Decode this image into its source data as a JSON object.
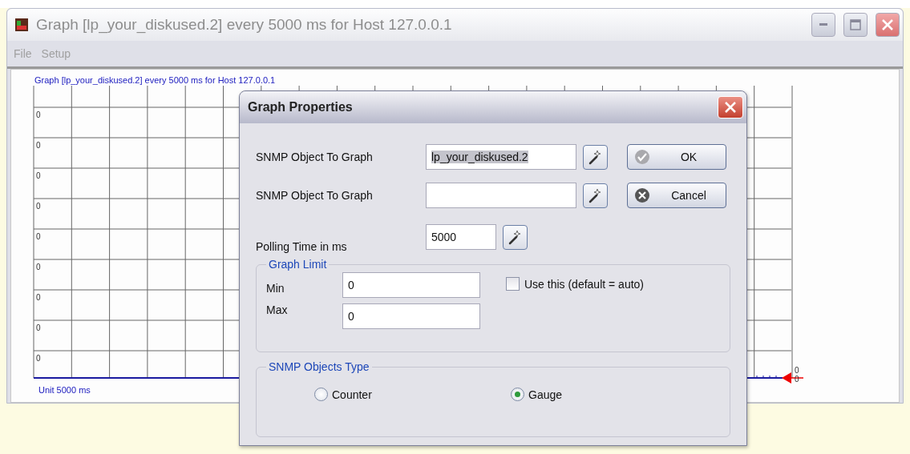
{
  "window": {
    "title": "Graph [lp_your_diskused.2] every 5000 ms for Host 127.0.0.1",
    "menu": [
      "File",
      "Setup"
    ]
  },
  "graph": {
    "title": "Graph [lp_your_diskused.2] every 5000 ms for Host 127.0.0.1",
    "y_labels": [
      "0",
      "0",
      "0",
      "0",
      "0",
      "0",
      "0",
      "0",
      "0"
    ],
    "unit": "Unit 5000 ms",
    "end_labels": [
      "0",
      "0"
    ]
  },
  "dialog": {
    "title": "Graph Properties",
    "rows": [
      {
        "label": "SNMP Object To Graph",
        "value": "lp_your_diskused.2",
        "highlighted": true,
        "button": {
          "kind": "ok",
          "label": "OK"
        }
      },
      {
        "label": "SNMP Object To Graph",
        "button": {
          "kind": "cancel",
          "label": "Cancel"
        }
      },
      {
        "label": "Polling Time in ms",
        "value": "5000"
      }
    ],
    "graph_limit": {
      "legend": "Graph Limit",
      "min": {
        "label": "Min",
        "value": "0"
      },
      "max": {
        "label": "Max",
        "value": "0"
      },
      "use_this": {
        "label": "Use this (default = auto)",
        "checked": false
      }
    },
    "objects_type": {
      "legend": "SNMP Objects Type",
      "options": [
        {
          "label": "Counter",
          "selected": false
        },
        {
          "label": "Gauge",
          "selected": true
        }
      ]
    }
  }
}
